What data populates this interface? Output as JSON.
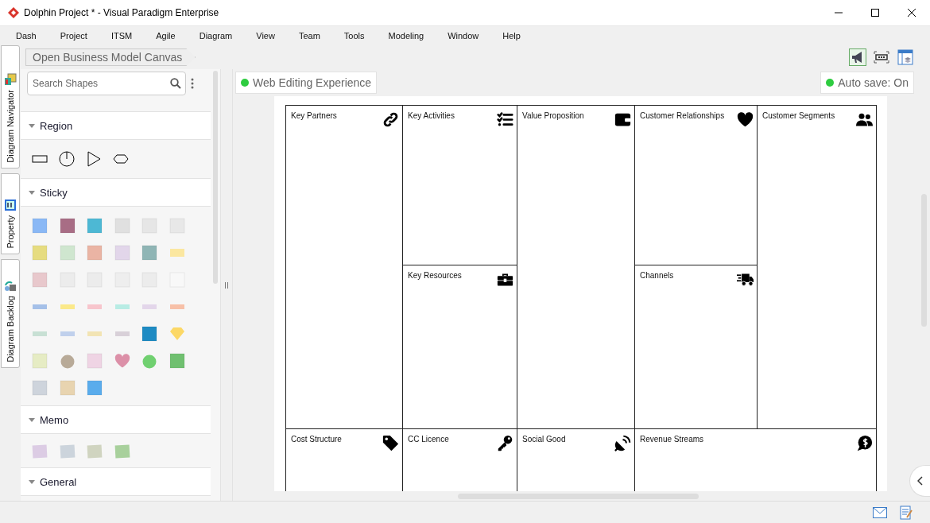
{
  "window": {
    "title": "Dolphin Project * - Visual Paradigm Enterprise"
  },
  "menu": [
    "Dash",
    "Project",
    "ITSM",
    "Agile",
    "Diagram",
    "View",
    "Team",
    "Tools",
    "Modeling",
    "Window",
    "Help"
  ],
  "side_tabs": [
    "Diagram Navigator",
    "Property",
    "Diagram Backlog"
  ],
  "breadcrumb": "Open Business Model Canvas",
  "shape_panel": {
    "search": {
      "placeholder": "Search Shapes"
    },
    "sections": [
      {
        "title": "Region",
        "kind": "region"
      },
      {
        "title": "Sticky",
        "kind": "sticky"
      },
      {
        "title": "Memo",
        "kind": "memo"
      },
      {
        "title": "General",
        "kind": "general"
      }
    ]
  },
  "canvas": {
    "web_editing": "Web Editing Experience",
    "auto_save": "Auto save: On",
    "blocks": [
      {
        "title": "Key Partners"
      },
      {
        "title": "Key Activities"
      },
      {
        "title": "Key Resources"
      },
      {
        "title": "Value Proposition"
      },
      {
        "title": "Customer Relationships"
      },
      {
        "title": "Channels"
      },
      {
        "title": "Customer Segments"
      },
      {
        "title": "Cost Structure"
      },
      {
        "title": "CC Licence"
      },
      {
        "title": "Social Good"
      },
      {
        "title": "Revenue Streams"
      }
    ]
  }
}
